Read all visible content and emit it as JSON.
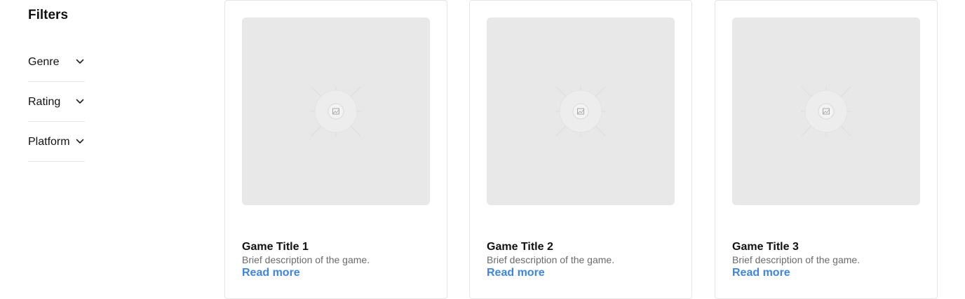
{
  "sidebar": {
    "title": "Filters",
    "filters": [
      {
        "label": "Genre",
        "icon": "chevron-down-icon"
      },
      {
        "label": "Rating",
        "icon": "chevron-down-icon"
      },
      {
        "label": "Platform",
        "icon": "chevron-down-icon"
      }
    ]
  },
  "cards": [
    {
      "title": "Game Title 1",
      "description": "Brief description of the game.",
      "link": "Read more",
      "image_icon": "image-placeholder-icon"
    },
    {
      "title": "Game Title 2",
      "description": "Brief description of the game.",
      "link": "Read more",
      "image_icon": "image-placeholder-icon"
    },
    {
      "title": "Game Title 3",
      "description": "Brief description of the game.",
      "link": "Read more",
      "image_icon": "image-placeholder-icon"
    }
  ],
  "colors": {
    "link": "#3d86e0",
    "placeholder_bg": "#e8e8e8",
    "border": "#e5e5e5",
    "muted_text": "#6b6b6b"
  }
}
